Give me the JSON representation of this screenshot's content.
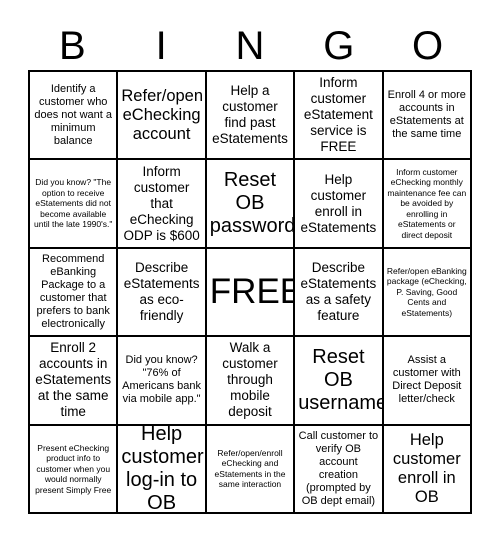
{
  "title": "BINGO",
  "header": {
    "letters": [
      "B",
      "I",
      "N",
      "G",
      "O"
    ]
  },
  "grid": {
    "rows": 5,
    "columns": 5,
    "border_color": "#000000",
    "background_color": "#ffffff",
    "text_color": "#000000",
    "cells": [
      {
        "text": "Identify a customer who does not want a minimum balance",
        "size": "s",
        "free": false
      },
      {
        "text": "Refer/open eChecking account",
        "size": "l",
        "free": false
      },
      {
        "text": "Help a customer find past eStatements",
        "size": "m",
        "free": false
      },
      {
        "text": "Inform customer eStatement service is FREE",
        "size": "m",
        "free": false
      },
      {
        "text": "Enroll 4 or more accounts in eStatements at the same time",
        "size": "s",
        "free": false
      },
      {
        "text": "Did you know? \"The option to receive eStatements did not become available until the late 1990's.\"",
        "size": "xs",
        "free": false
      },
      {
        "text": "Inform customer that eChecking ODP is $600",
        "size": "m",
        "free": false
      },
      {
        "text": "Reset OB password",
        "size": "xl",
        "free": false
      },
      {
        "text": "Help customer enroll in eStatements",
        "size": "m",
        "free": false
      },
      {
        "text": "Inform customer eChecking monthly maintenance fee can be avoided by enrolling in eStatements or direct deposit",
        "size": "xs",
        "free": false
      },
      {
        "text": "Recommend eBanking Package to a customer that prefers to bank electronically",
        "size": "s",
        "free": false
      },
      {
        "text": "Describe eStatements as eco-friendly",
        "size": "m",
        "free": false
      },
      {
        "text": "FREE",
        "size": "free",
        "free": true
      },
      {
        "text": "Describe eStatements as a safety feature",
        "size": "m",
        "free": false
      },
      {
        "text": "Refer/open eBanking package (eChecking, P. Saving, Good Cents and eStatements)",
        "size": "xs",
        "free": false
      },
      {
        "text": "Enroll 2 accounts in eStatements at the same time",
        "size": "m",
        "free": false
      },
      {
        "text": "Did you know? \"76% of Americans bank via mobile app.\"",
        "size": "s",
        "free": false
      },
      {
        "text": "Walk a customer through mobile deposit",
        "size": "m",
        "free": false
      },
      {
        "text": "Reset OB username",
        "size": "xl",
        "free": false
      },
      {
        "text": "Assist a customer with Direct Deposit letter/check",
        "size": "s",
        "free": false
      },
      {
        "text": "Present eChecking product info to customer when you would normally present Simply Free",
        "size": "xs",
        "free": false
      },
      {
        "text": "Help customer log-in to OB",
        "size": "xl",
        "free": false
      },
      {
        "text": "Refer/open/enroll eChecking and eStatements in the same interaction",
        "size": "xs",
        "free": false
      },
      {
        "text": "Call customer to verify OB account creation (prompted by OB dept email)",
        "size": "s",
        "free": false
      },
      {
        "text": "Help customer enroll in OB",
        "size": "l",
        "free": false
      }
    ]
  }
}
